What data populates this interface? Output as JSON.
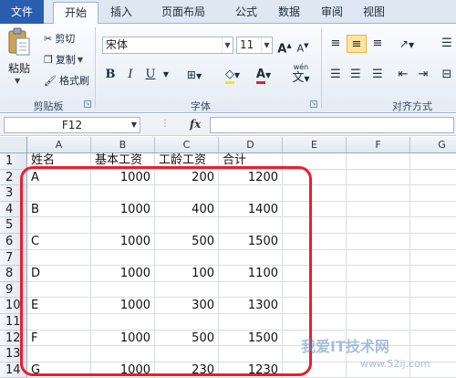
{
  "ribbon_tabs": [
    "文件",
    "开始",
    "插入",
    "页面布局",
    "公式",
    "数据",
    "审阅",
    "视图"
  ],
  "clipboard": {
    "paste_label": "粘贴",
    "cut_label": "剪切",
    "copy_label": "复制",
    "format_painter_label": "格式刷",
    "group_label": "剪贴板"
  },
  "font": {
    "name": "宋体",
    "size": "11",
    "group_label": "字体",
    "bold": "B",
    "italic": "I",
    "underline": "U",
    "font_color_glyph": "A",
    "phonetic_glyph": "wén",
    "phonetic_char": "文"
  },
  "alignment": {
    "group_label": "对齐方式"
  },
  "formula_bar": {
    "name_box": "F12",
    "fx": "fx",
    "formula": ""
  },
  "columns": [
    "A",
    "B",
    "C",
    "D",
    "E",
    "F",
    "G"
  ],
  "rows": [
    {
      "num": "1",
      "A": "姓名",
      "B": "基本工资",
      "C": "工龄工资",
      "D": "合计"
    },
    {
      "num": "2",
      "A": "A",
      "B": "1000",
      "C": "200",
      "D": "1200"
    },
    {
      "num": "3",
      "A": "",
      "B": "",
      "C": "",
      "D": ""
    },
    {
      "num": "4",
      "A": "B",
      "B": "1000",
      "C": "400",
      "D": "1400"
    },
    {
      "num": "5",
      "A": "",
      "B": "",
      "C": "",
      "D": ""
    },
    {
      "num": "6",
      "A": "C",
      "B": "1000",
      "C": "500",
      "D": "1500"
    },
    {
      "num": "7",
      "A": "",
      "B": "",
      "C": "",
      "D": ""
    },
    {
      "num": "8",
      "A": "D",
      "B": "1000",
      "C": "100",
      "D": "1100"
    },
    {
      "num": "9",
      "A": "",
      "B": "",
      "C": "",
      "D": ""
    },
    {
      "num": "10",
      "A": "E",
      "B": "1000",
      "C": "300",
      "D": "1300"
    },
    {
      "num": "11",
      "A": "",
      "B": "",
      "C": "",
      "D": ""
    },
    {
      "num": "12",
      "A": "F",
      "B": "1000",
      "C": "500",
      "D": "1500"
    },
    {
      "num": "13",
      "A": "",
      "B": "",
      "C": "",
      "D": ""
    },
    {
      "num": "14",
      "A": "G",
      "B": "1000",
      "C": "230",
      "D": "1230"
    }
  ],
  "watermark": {
    "text": "我爱IT技术网",
    "url": "www.52ij.com"
  },
  "colors": {
    "file_tab": "#2a5db0",
    "highlight": "#e81f2e",
    "selected_align": "#fde49a"
  }
}
